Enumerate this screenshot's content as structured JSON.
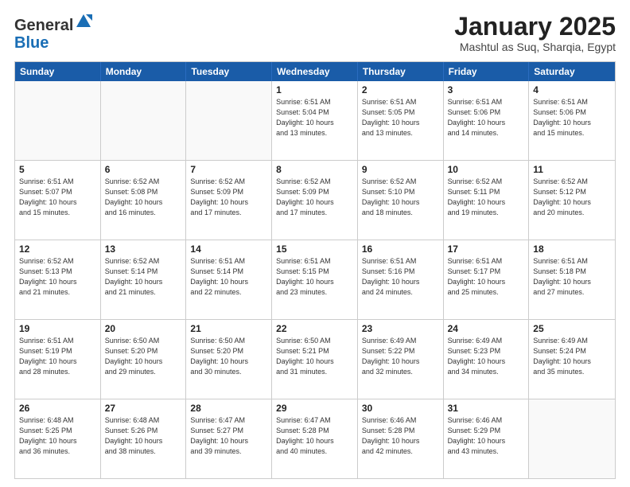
{
  "header": {
    "logo_general": "General",
    "logo_blue": "Blue",
    "month": "January 2025",
    "location": "Mashtul as Suq, Sharqia, Egypt"
  },
  "days_of_week": [
    "Sunday",
    "Monday",
    "Tuesday",
    "Wednesday",
    "Thursday",
    "Friday",
    "Saturday"
  ],
  "rows": [
    [
      {
        "day": "",
        "lines": []
      },
      {
        "day": "",
        "lines": []
      },
      {
        "day": "",
        "lines": []
      },
      {
        "day": "1",
        "lines": [
          "Sunrise: 6:51 AM",
          "Sunset: 5:04 PM",
          "Daylight: 10 hours",
          "and 13 minutes."
        ]
      },
      {
        "day": "2",
        "lines": [
          "Sunrise: 6:51 AM",
          "Sunset: 5:05 PM",
          "Daylight: 10 hours",
          "and 13 minutes."
        ]
      },
      {
        "day": "3",
        "lines": [
          "Sunrise: 6:51 AM",
          "Sunset: 5:06 PM",
          "Daylight: 10 hours",
          "and 14 minutes."
        ]
      },
      {
        "day": "4",
        "lines": [
          "Sunrise: 6:51 AM",
          "Sunset: 5:06 PM",
          "Daylight: 10 hours",
          "and 15 minutes."
        ]
      }
    ],
    [
      {
        "day": "5",
        "lines": [
          "Sunrise: 6:51 AM",
          "Sunset: 5:07 PM",
          "Daylight: 10 hours",
          "and 15 minutes."
        ]
      },
      {
        "day": "6",
        "lines": [
          "Sunrise: 6:52 AM",
          "Sunset: 5:08 PM",
          "Daylight: 10 hours",
          "and 16 minutes."
        ]
      },
      {
        "day": "7",
        "lines": [
          "Sunrise: 6:52 AM",
          "Sunset: 5:09 PM",
          "Daylight: 10 hours",
          "and 17 minutes."
        ]
      },
      {
        "day": "8",
        "lines": [
          "Sunrise: 6:52 AM",
          "Sunset: 5:09 PM",
          "Daylight: 10 hours",
          "and 17 minutes."
        ]
      },
      {
        "day": "9",
        "lines": [
          "Sunrise: 6:52 AM",
          "Sunset: 5:10 PM",
          "Daylight: 10 hours",
          "and 18 minutes."
        ]
      },
      {
        "day": "10",
        "lines": [
          "Sunrise: 6:52 AM",
          "Sunset: 5:11 PM",
          "Daylight: 10 hours",
          "and 19 minutes."
        ]
      },
      {
        "day": "11",
        "lines": [
          "Sunrise: 6:52 AM",
          "Sunset: 5:12 PM",
          "Daylight: 10 hours",
          "and 20 minutes."
        ]
      }
    ],
    [
      {
        "day": "12",
        "lines": [
          "Sunrise: 6:52 AM",
          "Sunset: 5:13 PM",
          "Daylight: 10 hours",
          "and 21 minutes."
        ]
      },
      {
        "day": "13",
        "lines": [
          "Sunrise: 6:52 AM",
          "Sunset: 5:14 PM",
          "Daylight: 10 hours",
          "and 21 minutes."
        ]
      },
      {
        "day": "14",
        "lines": [
          "Sunrise: 6:51 AM",
          "Sunset: 5:14 PM",
          "Daylight: 10 hours",
          "and 22 minutes."
        ]
      },
      {
        "day": "15",
        "lines": [
          "Sunrise: 6:51 AM",
          "Sunset: 5:15 PM",
          "Daylight: 10 hours",
          "and 23 minutes."
        ]
      },
      {
        "day": "16",
        "lines": [
          "Sunrise: 6:51 AM",
          "Sunset: 5:16 PM",
          "Daylight: 10 hours",
          "and 24 minutes."
        ]
      },
      {
        "day": "17",
        "lines": [
          "Sunrise: 6:51 AM",
          "Sunset: 5:17 PM",
          "Daylight: 10 hours",
          "and 25 minutes."
        ]
      },
      {
        "day": "18",
        "lines": [
          "Sunrise: 6:51 AM",
          "Sunset: 5:18 PM",
          "Daylight: 10 hours",
          "and 27 minutes."
        ]
      }
    ],
    [
      {
        "day": "19",
        "lines": [
          "Sunrise: 6:51 AM",
          "Sunset: 5:19 PM",
          "Daylight: 10 hours",
          "and 28 minutes."
        ]
      },
      {
        "day": "20",
        "lines": [
          "Sunrise: 6:50 AM",
          "Sunset: 5:20 PM",
          "Daylight: 10 hours",
          "and 29 minutes."
        ]
      },
      {
        "day": "21",
        "lines": [
          "Sunrise: 6:50 AM",
          "Sunset: 5:20 PM",
          "Daylight: 10 hours",
          "and 30 minutes."
        ]
      },
      {
        "day": "22",
        "lines": [
          "Sunrise: 6:50 AM",
          "Sunset: 5:21 PM",
          "Daylight: 10 hours",
          "and 31 minutes."
        ]
      },
      {
        "day": "23",
        "lines": [
          "Sunrise: 6:49 AM",
          "Sunset: 5:22 PM",
          "Daylight: 10 hours",
          "and 32 minutes."
        ]
      },
      {
        "day": "24",
        "lines": [
          "Sunrise: 6:49 AM",
          "Sunset: 5:23 PM",
          "Daylight: 10 hours",
          "and 34 minutes."
        ]
      },
      {
        "day": "25",
        "lines": [
          "Sunrise: 6:49 AM",
          "Sunset: 5:24 PM",
          "Daylight: 10 hours",
          "and 35 minutes."
        ]
      }
    ],
    [
      {
        "day": "26",
        "lines": [
          "Sunrise: 6:48 AM",
          "Sunset: 5:25 PM",
          "Daylight: 10 hours",
          "and 36 minutes."
        ]
      },
      {
        "day": "27",
        "lines": [
          "Sunrise: 6:48 AM",
          "Sunset: 5:26 PM",
          "Daylight: 10 hours",
          "and 38 minutes."
        ]
      },
      {
        "day": "28",
        "lines": [
          "Sunrise: 6:47 AM",
          "Sunset: 5:27 PM",
          "Daylight: 10 hours",
          "and 39 minutes."
        ]
      },
      {
        "day": "29",
        "lines": [
          "Sunrise: 6:47 AM",
          "Sunset: 5:28 PM",
          "Daylight: 10 hours",
          "and 40 minutes."
        ]
      },
      {
        "day": "30",
        "lines": [
          "Sunrise: 6:46 AM",
          "Sunset: 5:28 PM",
          "Daylight: 10 hours",
          "and 42 minutes."
        ]
      },
      {
        "day": "31",
        "lines": [
          "Sunrise: 6:46 AM",
          "Sunset: 5:29 PM",
          "Daylight: 10 hours",
          "and 43 minutes."
        ]
      },
      {
        "day": "",
        "lines": []
      }
    ]
  ]
}
